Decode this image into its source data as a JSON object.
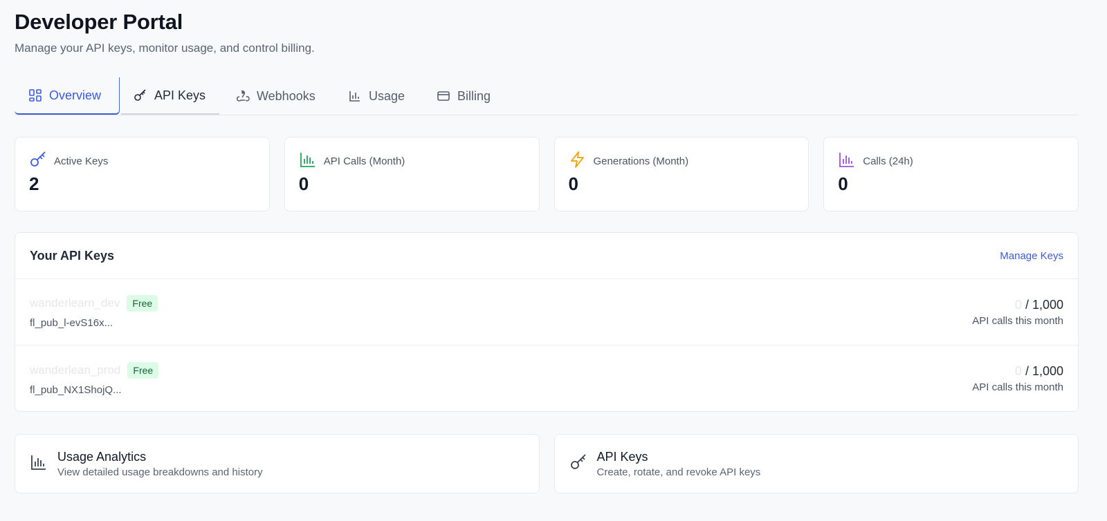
{
  "header": {
    "title": "Developer Portal",
    "subtitle": "Manage your API keys, monitor usage, and control billing."
  },
  "tabs": [
    {
      "label": "Overview",
      "icon": "dashboard-icon",
      "active": true
    },
    {
      "label": "API Keys",
      "icon": "key-icon"
    },
    {
      "label": "Webhooks",
      "icon": "webhook-icon"
    },
    {
      "label": "Usage",
      "icon": "bar-chart-icon"
    },
    {
      "label": "Billing",
      "icon": "credit-card-icon"
    }
  ],
  "stats": [
    {
      "label": "Active Keys",
      "value": "2",
      "icon": "key-icon",
      "color": "#3b5bdb"
    },
    {
      "label": "API Calls (Month)",
      "value": "0",
      "icon": "bar-chart-icon",
      "color": "#22a55b"
    },
    {
      "label": "Generations (Month)",
      "value": "0",
      "icon": "lightning-icon",
      "color": "#f59f00"
    },
    {
      "label": "Calls (24h)",
      "value": "0",
      "icon": "bar-chart-icon",
      "color": "#9b51e0"
    }
  ],
  "keys_panel": {
    "title": "Your API Keys",
    "manage_label": "Manage Keys",
    "keys": [
      {
        "name": "wanderlearn_dev",
        "plan": "Free",
        "id": "fl_pub_l-evS16x...",
        "used": "0",
        "limit": "/ 1,000",
        "caption": "API calls this month"
      },
      {
        "name": "wanderlean_prod",
        "plan": "Free",
        "id": "fl_pub_NX1ShojQ...",
        "used": "0",
        "limit": "/ 1,000",
        "caption": "API calls this month"
      }
    ]
  },
  "quick_links": [
    {
      "title": "Usage Analytics",
      "desc": "View detailed usage breakdowns and history",
      "icon": "bar-chart-icon"
    },
    {
      "title": "API Keys",
      "desc": "Create, rotate, and revoke API keys",
      "icon": "key-icon"
    }
  ],
  "colors": {
    "accent": "#3b5bdb",
    "badge_bg": "#dcfce7",
    "badge_text": "#166534"
  }
}
